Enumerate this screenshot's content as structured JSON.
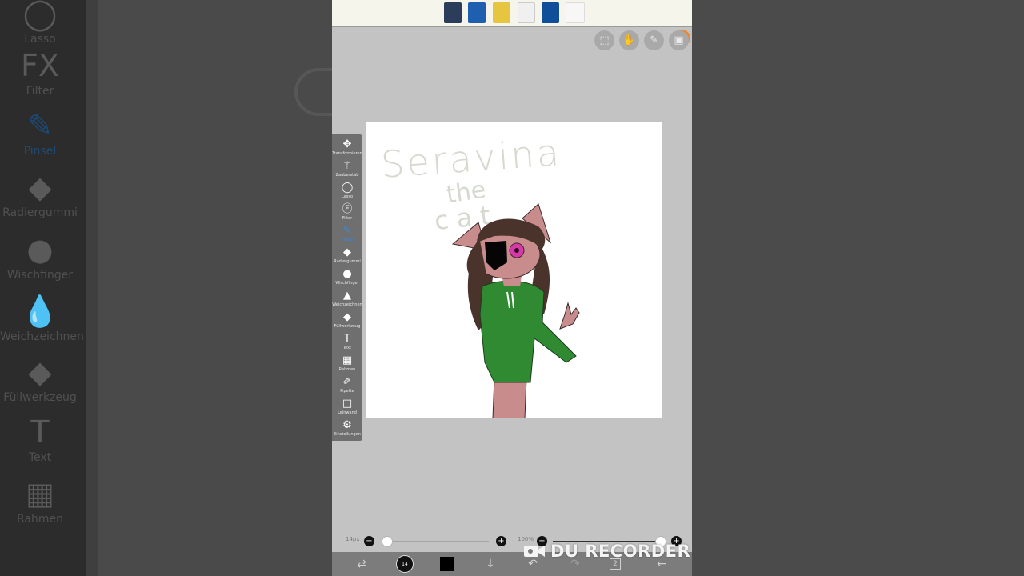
{
  "background_left": {
    "items": [
      {
        "label": "Lasso",
        "icon": "lasso-icon",
        "glyph": "◯"
      },
      {
        "label": "Filter",
        "icon": "fx-icon",
        "glyph": "FX"
      },
      {
        "label": "Pinsel",
        "icon": "brush-icon",
        "glyph": "✎"
      },
      {
        "label": "Radiergummi",
        "icon": "eraser-icon",
        "glyph": "◆"
      },
      {
        "label": "Wischfinger",
        "icon": "smudge-icon",
        "glyph": "●"
      },
      {
        "label": "Weichzeichnen",
        "icon": "blur-icon",
        "glyph": "💧"
      },
      {
        "label": "Füllwerkzeug",
        "icon": "fill-icon",
        "glyph": "◆"
      },
      {
        "label": "Text",
        "icon": "text-icon",
        "glyph": "T"
      },
      {
        "label": "Rahmen",
        "icon": "frame-icon",
        "glyph": "▦"
      }
    ]
  },
  "toolbar": {
    "tools": [
      {
        "label": "Transformieren",
        "icon": "move-icon",
        "glyph": "✥"
      },
      {
        "label": "Zauberstab",
        "icon": "magic-wand-icon",
        "glyph": "⚚"
      },
      {
        "label": "Lasso",
        "icon": "lasso-icon",
        "glyph": "◯"
      },
      {
        "label": "Filter",
        "icon": "fx-icon",
        "glyph": "Ⓕ"
      },
      {
        "label": "Pinsel",
        "icon": "brush-icon",
        "glyph": "✎",
        "active": true
      },
      {
        "label": "Radiergummi",
        "icon": "eraser-icon",
        "glyph": "◆"
      },
      {
        "label": "Wischfinger",
        "icon": "smudge-icon",
        "glyph": "●"
      },
      {
        "label": "Weichzeichnen",
        "icon": "blur-icon",
        "glyph": "▲"
      },
      {
        "label": "Füllwerkzeug",
        "icon": "fill-icon",
        "glyph": "◆"
      },
      {
        "label": "Text",
        "icon": "text-icon",
        "glyph": "T"
      },
      {
        "label": "Rahmen",
        "icon": "frame-icon",
        "glyph": "▦"
      },
      {
        "label": "Pipette",
        "icon": "eyedropper-icon",
        "glyph": "✐"
      },
      {
        "label": "Leinwand",
        "icon": "canvas-icon",
        "glyph": "□"
      },
      {
        "label": "Einstellungen",
        "icon": "settings-icon",
        "glyph": "⚙"
      }
    ]
  },
  "top_icons": [
    {
      "name": "selection-icon",
      "glyph": "⬚"
    },
    {
      "name": "hand-icon",
      "glyph": "✋"
    },
    {
      "name": "pen-icon",
      "glyph": "✎"
    },
    {
      "name": "layer-image-icon",
      "glyph": "▣"
    }
  ],
  "artwork": {
    "title": "Seravina",
    "subtitle_1": "the",
    "subtitle_2": "cat"
  },
  "sliders": {
    "brush_size": "14px",
    "minus": "−",
    "plus": "+",
    "brush_size_fraction": 0.0,
    "opacity": "100%",
    "opacity_fraction": 1.0
  },
  "bottom_bar": {
    "brush_badge": "14",
    "layers_count": "2"
  },
  "watermark": "DU RECORDER",
  "colors": {
    "active_tool": "#3a8ad6",
    "hoodie": "#2f8a32",
    "hair": "#4a332b",
    "skin": "#c98c8c",
    "eye": "#d63aa6"
  }
}
